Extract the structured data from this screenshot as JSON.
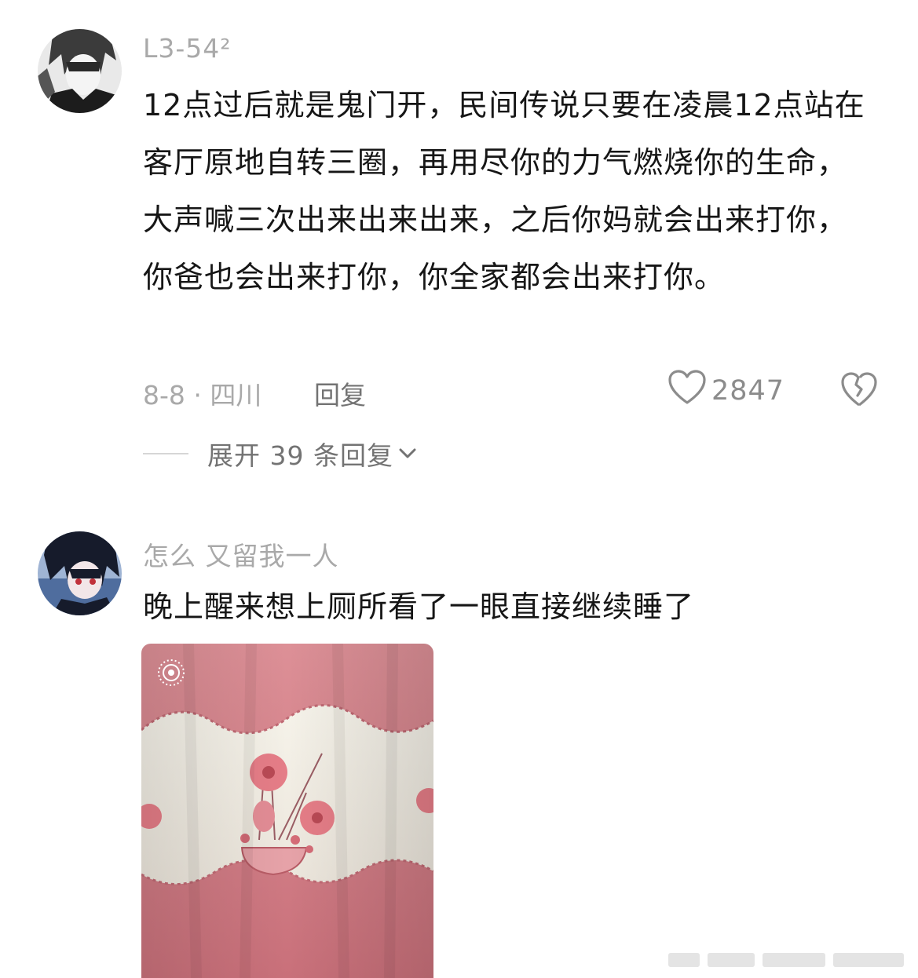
{
  "comments": [
    {
      "username": "L3-54²",
      "text": "12点过后就是鬼门开，民间传说只要在凌晨12点站在客厅原地自转三圈，再用尽你的力气燃烧你的生命，大声喊三次出来出来出来，之后你妈就会出来打你，你爸也会出来打你，你全家都会出来打你。",
      "date_location": "8-8 · 四川",
      "reply_label": "回复",
      "like_count": "2847",
      "expand_label": "展开 39 条回复"
    },
    {
      "username": "怎么 又留我一人",
      "text": "晚上醒来想上厕所看了一眼直接继续睡了"
    }
  ],
  "icons": {
    "like": "heart-outline-icon",
    "dislike": "broken-heart-icon",
    "expand": "chevron-down-icon",
    "photo_overlay": "live-photo-icon"
  },
  "colors": {
    "username": "#a9a9a9",
    "body_text": "#161616",
    "meta_text": "#a9a9a9",
    "action_text": "#737373",
    "curtain_pink": "#d77f86"
  }
}
